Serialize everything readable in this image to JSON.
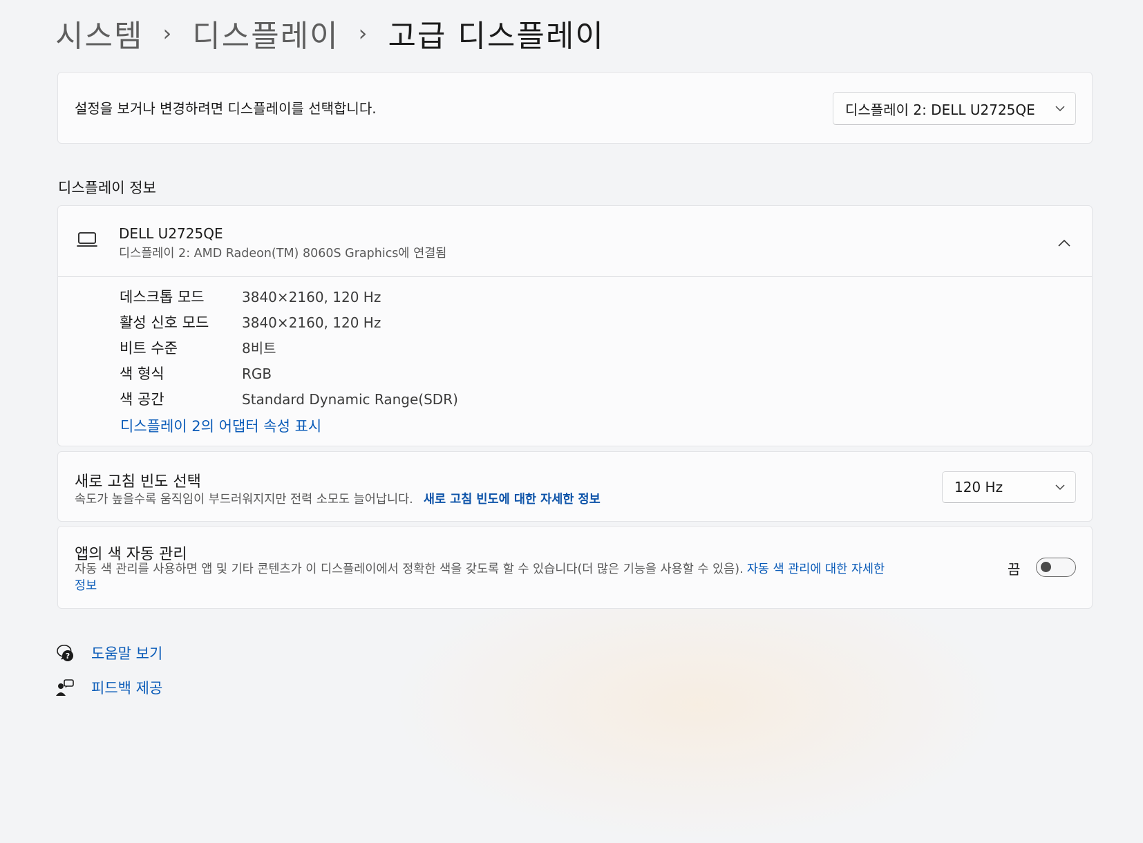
{
  "breadcrumb": {
    "items": [
      "시스템",
      "디스플레이",
      "고급 디스플레이"
    ],
    "separator": "›"
  },
  "display_select": {
    "prompt": "설정을 보거나 변경하려면 디스플레이를 선택합니다.",
    "selected": "디스플레이 2: DELL U2725QE"
  },
  "display_info": {
    "section_title": "디스플레이 정보",
    "monitor_name": "DELL U2725QE",
    "monitor_subtitle": "디스플레이 2: AMD Radeon(TM) 8060S Graphics에 연결됨",
    "rows": [
      {
        "label": "데스크톱 모드",
        "value": "3840×2160, 120 Hz"
      },
      {
        "label": "활성 신호 모드",
        "value": "3840×2160, 120 Hz"
      },
      {
        "label": "비트 수준",
        "value": "8비트"
      },
      {
        "label": "색 형식",
        "value": "RGB"
      },
      {
        "label": "색 공간",
        "value": "Standard Dynamic Range(SDR)"
      }
    ],
    "adapter_link": "디스플레이 2의 어댑터 속성 표시"
  },
  "refresh_rate": {
    "title": "새로 고침 빈도 선택",
    "description": "속도가 높을수록 움직임이 부드러워지지만 전력 소모도 늘어납니다.",
    "link": "새로 고침 빈도에 대한 자세한 정보",
    "selected": "120 Hz"
  },
  "auto_color": {
    "title": "앱의 색 자동 관리",
    "description": "자동 색 관리를 사용하면 앱 및 기타 콘텐츠가 이 디스플레이에서 정확한 색을 갖도록 할 수 있습니다(더 많은 기능을 사용할 수 있음).",
    "link_part1": "자동 색 관리에 대한 자세한",
    "link_part2": "정보",
    "toggle_label": "끔",
    "toggle_on": false
  },
  "footer": {
    "help": "도움말 보기",
    "feedback": "피드백 제공"
  },
  "icons": {
    "monitor": "laptop-icon",
    "chevron_up": "chevron-up-icon",
    "chevron_down": "chevron-down-icon",
    "help": "help-chat-icon",
    "feedback": "feedback-icon"
  },
  "colors": {
    "link": "#0a5bb8",
    "background": "#f3f4f6",
    "card": "#fbfbfc"
  }
}
